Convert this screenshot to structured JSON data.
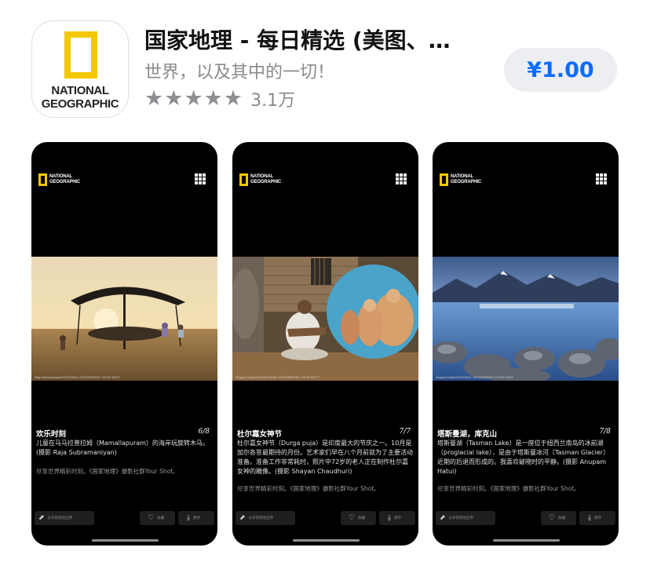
{
  "app": {
    "icon_line1": "NATIONAL",
    "icon_line2": "GEOGRAPHIC",
    "title": "国家地理 - 每日精选 (美图、…",
    "subtitle": "世界，以及其中的一切！",
    "stars": "★★★★★",
    "rating_count": "3.1万",
    "price": "¥1.00"
  },
  "colors": {
    "accent": "#0a6cff",
    "ng_yellow": "#f3c800",
    "star_gray": "#8e8e93",
    "price_button_bg": "#eceef2"
  },
  "screenshots": [
    {
      "logo_line1": "NATIONAL",
      "logo_line2": "GEOGRAPHIC",
      "photo_credit": "Raja Subramaniyan/NATIONAL GEOGRAPHIC YOUR SHOT",
      "caption_title": "欢乐时刻",
      "page": "6/8",
      "caption_body": "儿童在马马拉普拉姆（Mamallapuram）的海岸玩旋转木马。(摄影 Raja Subramaniyan)",
      "footer": "尽享世界精彩时刻。《国家地理》摄影社群Your Shot。",
      "share_label": "分享到其他应用",
      "like_label": "收藏",
      "download_label": "保存"
    },
    {
      "logo_line1": "NATIONAL",
      "logo_line2": "GEOGRAPHIC",
      "photo_credit": "Shayan Chaudhuri/NATIONAL GEOGRAPHIC YOUR SHOT",
      "caption_title": "杜尔嘉女神节",
      "page": "7/7",
      "caption_body": "杜尔嘉女神节（Durga puja）是印度最大的节庆之一。10月是加尔各答最期待的月份。艺术家们早在八个月前就为了主要活动准备。准备工作非常耗时，照片中72岁的老人正在制作杜尔嘉女神的雕像。(摄影 Shayan Chaudhuri)",
      "footer": "尽享世界精彩时刻。《国家地理》摄影社群Your Shot。",
      "share_label": "分享到其他应用",
      "like_label": "收藏",
      "download_label": "保存"
    },
    {
      "logo_line1": "NATIONAL",
      "logo_line2": "GEOGRAPHIC",
      "photo_credit": "Anupam Hatui/NATIONAL GEOGRAPHIC YOUR SHOT",
      "caption_title": "塔斯曼湖，库克山",
      "page": "7/8",
      "caption_body": "塔斯曼湖（Tasman Lake）是一座位于纽西兰南岛的冰前湖（proglacial lake），是由于塔斯曼冰河（Tasman Glacier）近期的后退而形成的。我喜欢破晓时的平静。(摄影 Anupam Hatui)",
      "footer": "尽享世界精彩时刻。《国家地理》摄影社群Your Shot。",
      "share_label": "分享到其他应用",
      "like_label": "收藏",
      "download_label": "保存"
    }
  ]
}
